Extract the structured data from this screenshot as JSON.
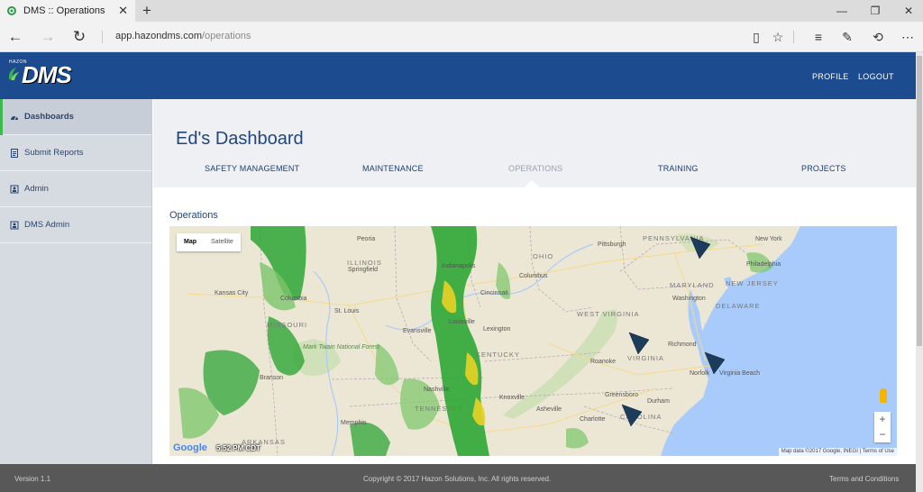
{
  "browser": {
    "tab_title": "DMS :: Operations",
    "url_host": "app.hazondms.com",
    "url_path": "/operations"
  },
  "header": {
    "logo_top": "HAZON",
    "logo_text": "DMS",
    "nav": [
      "PROFILE",
      "LOGOUT"
    ]
  },
  "sidebar": {
    "items": [
      {
        "label": "Dashboards",
        "icon": "dashboard-icon"
      },
      {
        "label": "Submit Reports",
        "icon": "report-icon"
      },
      {
        "label": "Admin",
        "icon": "admin-icon"
      },
      {
        "label": "DMS Admin",
        "icon": "admin-icon"
      }
    ]
  },
  "main": {
    "title": "Ed's Dashboard",
    "tabs": [
      "SAFETY MANAGEMENT",
      "MAINTENANCE",
      "OPERATIONS",
      "TRAINING",
      "PROJECTS"
    ],
    "active_tab": "OPERATIONS",
    "section_title": "Operations"
  },
  "map": {
    "type_buttons": [
      "Map",
      "Satellite"
    ],
    "google_label": "Google",
    "radar_time": "5:52 PM CDT",
    "attribution": "Map data ©2017 Google, INEGI  |  Terms of Use",
    "zoom_in": "+",
    "zoom_out": "−",
    "labels": [
      "Pittsburgh",
      "PENNSYLVANIA",
      "New York",
      "Philadelphia",
      "MARYLAND",
      "NEW JERSEY",
      "Washington",
      "DELAWARE",
      "OHIO",
      "Columbus",
      "Cincinnati",
      "ILLINOIS",
      "Springfield",
      "Peoria",
      "Indianapolis",
      "Kansas City",
      "Columbia",
      "MISSOURI",
      "St. Louis",
      "Evansville",
      "Louisville",
      "Lexington",
      "WEST VIRGINIA",
      "VIRGINIA",
      "Richmond",
      "Roanoke",
      "Norfolk",
      "Virginia Beach",
      "Knoxville",
      "Nashville",
      "TENNESSEE",
      "Memphis",
      "ARKANSAS",
      "Greensboro",
      "Durham",
      "Charlotte",
      "CAROLINA",
      "Asheville",
      "Branson",
      "Mark Twain National Forest",
      "KENTUCKY"
    ],
    "colors": {
      "land": "#ece7d4",
      "water": "#a9cbfb",
      "forest": "#c9dfb0",
      "radar_green": "#2ea635",
      "radar_yellow": "#e8d323",
      "marker": "#1d3b5a"
    }
  },
  "footer": {
    "version": "Version 1.1",
    "copyright": "Copyright © 2017 Hazon Solutions, Inc. All rights reserved.",
    "terms": "Terms and Conditions"
  },
  "theme": {
    "header_blue": "#1d4b8f",
    "accent_green": "#3cba4d"
  }
}
